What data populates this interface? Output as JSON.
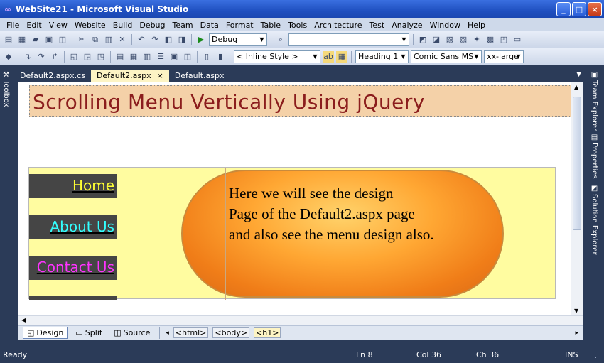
{
  "window": {
    "title": "WebSite21 - Microsoft Visual Studio",
    "minimize": "_",
    "maximize": "□",
    "close": "×"
  },
  "menu": [
    "File",
    "Edit",
    "View",
    "Website",
    "Build",
    "Debug",
    "Team",
    "Data",
    "Format",
    "Table",
    "Tools",
    "Architecture",
    "Test",
    "Analyze",
    "Window",
    "Help"
  ],
  "toolbar1": {
    "config_combo": "Debug",
    "find_combo": ""
  },
  "toolbar2": {
    "style_combo": "< Inline Style >",
    "block_combo": "Heading 1",
    "font_combo": "Comic Sans MS",
    "size_combo": "xx-large"
  },
  "tabs": [
    {
      "label": "Default2.aspx.cs"
    },
    {
      "label": "Default2.aspx"
    },
    {
      "label": "Default.aspx"
    }
  ],
  "tab_close": "×",
  "side_left": {
    "toolbox": "Toolbox"
  },
  "side_right": {
    "team_explorer": "Team Explorer",
    "properties": "Properties",
    "solution_explorer": "Solution Explorer"
  },
  "page": {
    "heading": "Scrolling Menu Vertically Using jQuery",
    "menu_items": [
      {
        "label": "Home",
        "color": "#ffff33"
      },
      {
        "label": "About Us",
        "color": "#33ffff"
      },
      {
        "label": "Contact Us",
        "color": "#ff33ff"
      }
    ],
    "content_lines": [
      "Here we will see the design",
      "Page of the Default2.aspx page",
      "and also see the menu design also."
    ]
  },
  "design_bar": {
    "design": "Design",
    "split": "Split",
    "source": "Source",
    "crumbs": [
      "<html>",
      "<body>",
      "<h1>"
    ]
  },
  "status": {
    "state": "Ready",
    "ln": "Ln 8",
    "col": "Col 36",
    "ch": "Ch 36",
    "mode": "INS"
  }
}
